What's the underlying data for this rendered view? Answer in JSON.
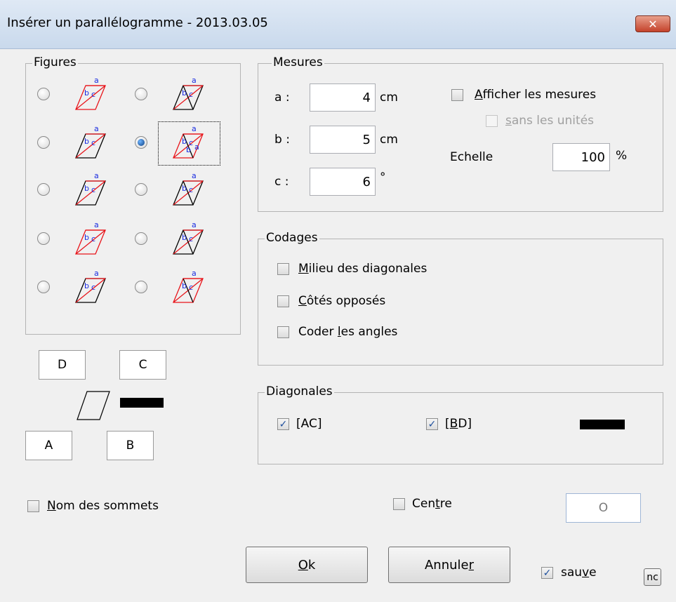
{
  "window": {
    "title": "Insérer un parallélogramme - 2013.03.05",
    "close_glyph": "✕"
  },
  "figures": {
    "legend": "Figures",
    "selected_index": 3,
    "options": [
      {
        "labels": [
          "a",
          "b",
          "c"
        ]
      },
      {
        "labels": [
          "a",
          "b",
          "c"
        ]
      },
      {
        "labels": [
          "a",
          "b",
          "c"
        ]
      },
      {
        "labels": [
          "a",
          "b",
          "c",
          "a",
          "b"
        ]
      },
      {
        "labels": [
          "a",
          "b",
          "c"
        ]
      },
      {
        "labels": [
          "a",
          "b",
          "c"
        ]
      },
      {
        "labels": [
          "a",
          "b",
          "c"
        ]
      },
      {
        "labels": [
          "a",
          "b",
          "c"
        ]
      },
      {
        "labels": [
          "a",
          "b",
          "c"
        ]
      },
      {
        "labels": [
          "a",
          "b",
          "c"
        ]
      }
    ]
  },
  "vertices": {
    "D": "D",
    "C": "C",
    "A": "A",
    "B": "B"
  },
  "mesures": {
    "legend": "Mesures",
    "a": {
      "label": "a :",
      "value": "4",
      "unit": "cm"
    },
    "b": {
      "label": "b :",
      "value": "5",
      "unit": "cm"
    },
    "c": {
      "label": "c :",
      "value": "6",
      "unit": "°"
    },
    "afficher": {
      "first": "A",
      "rest": "fficher les mesures",
      "checked": false
    },
    "sans_unites": {
      "first": "s",
      "rest": "ans les unités",
      "checked": false
    },
    "echelle": {
      "label": "Echelle",
      "value": "100",
      "unit": "%"
    }
  },
  "codages": {
    "legend": "Codages",
    "milieu": {
      "first": "M",
      "rest": "ilieu des diagonales",
      "checked": false
    },
    "cotes": {
      "first": "C",
      "rest": "ôtés opposés",
      "checked": false
    },
    "angles": {
      "pre": "Coder ",
      "mid": "l",
      "post": "es angles",
      "checked": false
    }
  },
  "diagonales": {
    "legend": "Diagonales",
    "ac": {
      "label": "[AC]",
      "checked": true
    },
    "bd": {
      "pre": "[",
      "mid": "B",
      "post": "D]",
      "checked": true
    }
  },
  "nom_sommets": {
    "first": "N",
    "rest": "om des sommets",
    "checked": false
  },
  "centre": {
    "pre": "Cen",
    "mid": "t",
    "post": "re",
    "checked": false,
    "value": "O"
  },
  "buttons": {
    "ok": {
      "first": "O",
      "rest": "k"
    },
    "annuler": {
      "pre": "Annule",
      "mid": "r"
    },
    "nc": "nc"
  },
  "sauve": {
    "pre": "sau",
    "mid": "v",
    "post": "e",
    "checked": true
  },
  "check_glyph": "✓",
  "colors": {
    "red": "#e8141a",
    "blue": "#1a2ce0",
    "black": "#000000"
  }
}
